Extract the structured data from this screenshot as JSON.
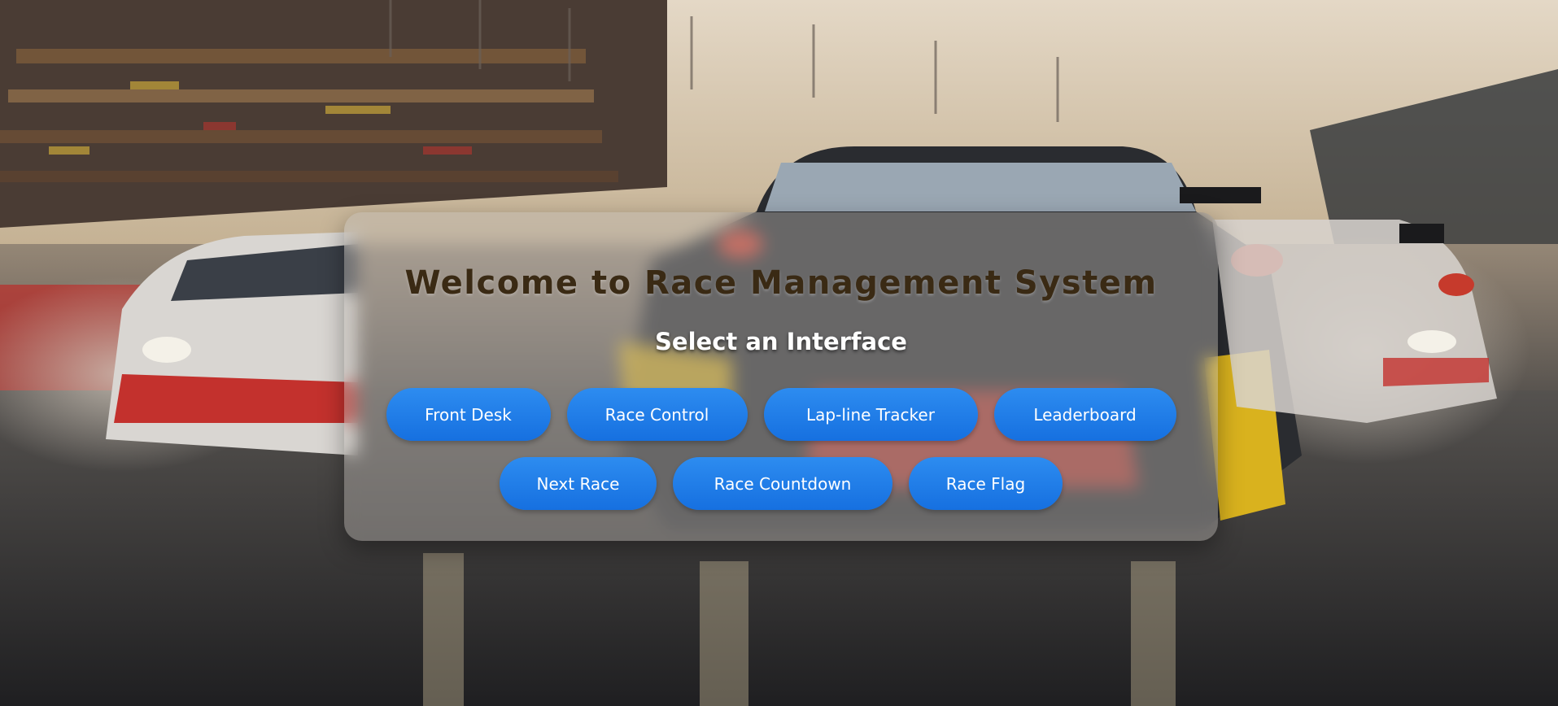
{
  "title": "Welcome to Race Management System",
  "subtitle": "Select an Interface",
  "buttons_row1": [
    {
      "label": "Front Desk"
    },
    {
      "label": "Race Control"
    },
    {
      "label": "Lap-line Tracker"
    },
    {
      "label": "Leaderboard"
    }
  ],
  "buttons_row2": [
    {
      "label": "Next Race"
    },
    {
      "label": "Race Countdown"
    },
    {
      "label": "Race Flag"
    }
  ],
  "colors": {
    "button": "#1a78e6",
    "title": "#3a2a14",
    "subtitle": "#ffffff"
  },
  "background_image": "race-cars-on-wet-track"
}
